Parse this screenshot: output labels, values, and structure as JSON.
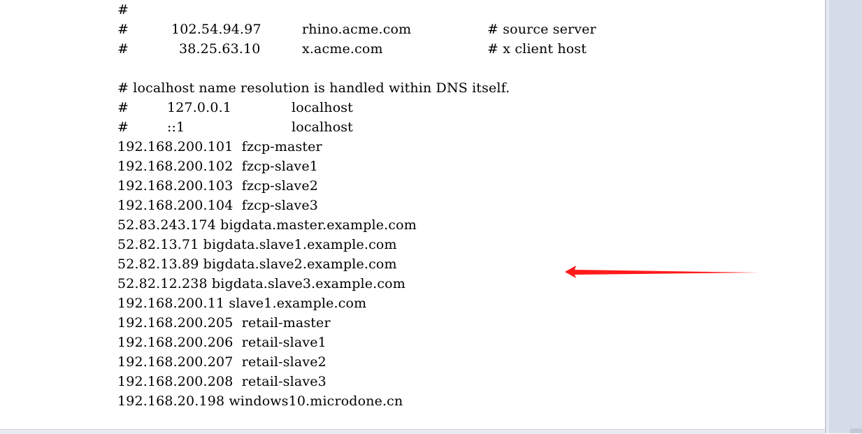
{
  "hosts_file": {
    "lines": [
      {
        "segs": [
          "#"
        ]
      },
      {
        "segs": [
          "#",
          "102.54.94.97",
          "rhino.acme.com",
          "# source server"
        ]
      },
      {
        "segs": [
          "#",
          "38.25.63.10",
          "x.acme.com",
          "# x client host"
        ]
      },
      {
        "segs": [
          ""
        ]
      },
      {
        "segs": [
          "# localhost name resolution is handled within DNS itself."
        ]
      },
      {
        "segs": [
          "#",
          "127.0.0.1",
          "localhost"
        ]
      },
      {
        "segs": [
          "#",
          "::1",
          "localhost"
        ]
      },
      {
        "segs": [
          "192.168.200.101  fzcp-master"
        ]
      },
      {
        "segs": [
          "192.168.200.102  fzcp-slave1"
        ]
      },
      {
        "segs": [
          "192.168.200.103  fzcp-slave2"
        ]
      },
      {
        "segs": [
          "192.168.200.104  fzcp-slave3"
        ]
      },
      {
        "segs": [
          "52.83.243.174 bigdata.master.example.com"
        ]
      },
      {
        "segs": [
          "52.82.13.71 bigdata.slave1.example.com"
        ]
      },
      {
        "segs": [
          "52.82.13.89 bigdata.slave2.example.com"
        ]
      },
      {
        "segs": [
          "52.82.12.238 bigdata.slave3.example.com"
        ]
      },
      {
        "segs": [
          "192.168.200.11 slave1.example.com"
        ]
      },
      {
        "segs": [
          "192.168.200.205  retail-master"
        ]
      },
      {
        "segs": [
          "192.168.200.206  retail-slave1"
        ]
      },
      {
        "segs": [
          "192.168.200.207  retail-slave2"
        ]
      },
      {
        "segs": [
          "192.168.200.208  retail-slave3"
        ]
      },
      {
        "segs": [
          "192.168.20.198 windows10.microdone.cn"
        ]
      }
    ]
  },
  "annotation": {
    "arrow_color": "#ff1a1a",
    "arrow_icon": "red-arrow-left-icon"
  },
  "colors": {
    "text": "#000000",
    "background": "#ffffff",
    "scrollbar": "#d6dbe9"
  }
}
